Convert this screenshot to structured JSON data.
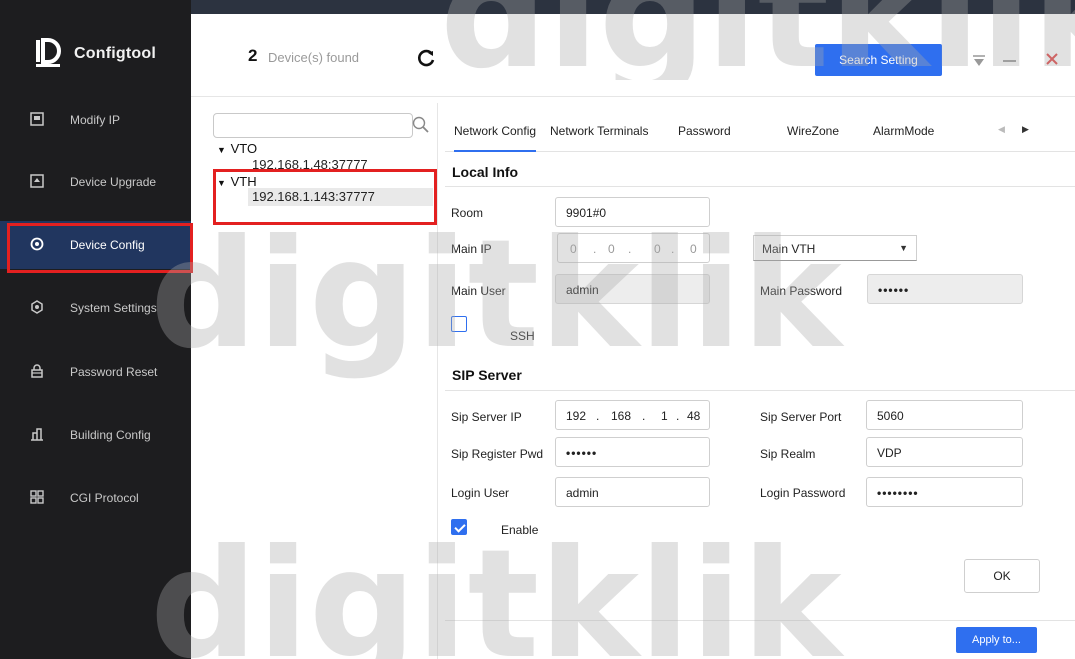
{
  "app": {
    "title": "Configtool"
  },
  "sidebar": {
    "items": [
      {
        "label": "Modify IP",
        "icon": "ip-icon"
      },
      {
        "label": "Device Upgrade",
        "icon": "upgrade-icon"
      },
      {
        "label": "Device Config",
        "icon": "config-icon",
        "active": true
      },
      {
        "label": "System Settings",
        "icon": "settings-icon"
      },
      {
        "label": "Password Reset",
        "icon": "lock-icon"
      },
      {
        "label": "Building Config",
        "icon": "building-icon"
      },
      {
        "label": "CGI Protocol",
        "icon": "cgi-icon"
      }
    ]
  },
  "topbar": {
    "device_count": "2",
    "device_count_label": "Device(s) found",
    "search_setting": "Search Setting"
  },
  "tree": {
    "search_placeholder": "",
    "groups": [
      {
        "name": "VTO",
        "children": [
          "192.168.1.48:37777"
        ]
      },
      {
        "name": "VTH",
        "children": [
          "192.168.1.143:37777"
        ]
      }
    ]
  },
  "tabs": [
    "Network Config",
    "Network Terminals",
    "Password",
    "WireZone",
    "AlarmMode"
  ],
  "local_info": {
    "title": "Local Info",
    "room_label": "Room",
    "room_value": "9901#0",
    "main_ip_label": "Main IP",
    "main_ip": [
      "0",
      "0",
      "0",
      "0"
    ],
    "main_type_value": "Main VTH",
    "main_user_label": "Main User",
    "main_user_value": "admin",
    "main_password_label": "Main Password",
    "main_password_value": "••••••",
    "ssh_label": "SSH"
  },
  "sip_server": {
    "title": "SIP Server",
    "server_ip_label": "Sip Server IP",
    "server_ip": [
      "192",
      "168",
      "1",
      "48"
    ],
    "server_port_label": "Sip Server Port",
    "server_port_value": "5060",
    "register_pwd_label": "Sip Register Pwd",
    "register_pwd_value": "••••••",
    "realm_label": "Sip Realm",
    "realm_value": "VDP",
    "login_user_label": "Login User",
    "login_user_value": "admin",
    "login_password_label": "Login Password",
    "login_password_value": "••••••••",
    "enable_label": "Enable"
  },
  "actions": {
    "ok": "OK",
    "apply": "Apply to..."
  },
  "watermark": "digitklik",
  "colors": {
    "accent": "#2f6fef",
    "sidebar": "#1d1d1f",
    "highlight": "#e32020"
  }
}
